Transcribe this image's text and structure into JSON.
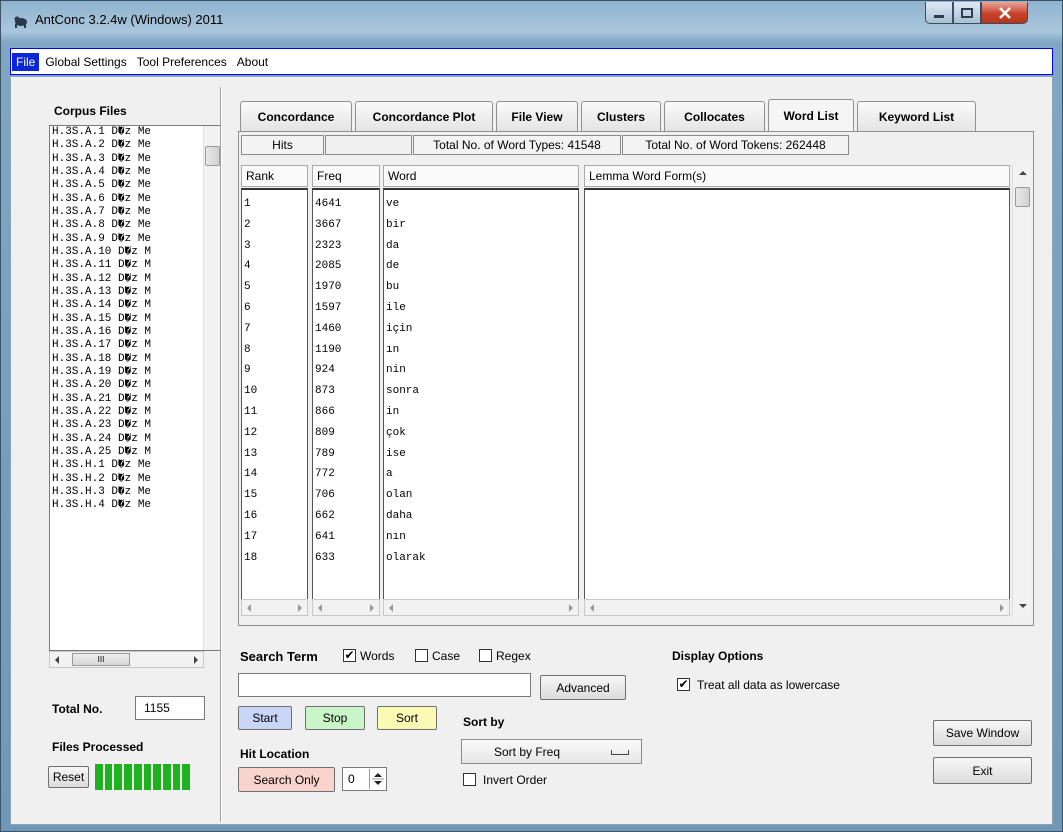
{
  "window": {
    "title": "AntConc 3.2.4w (Windows) 2011"
  },
  "menu": [
    "File",
    "Global Settings",
    "Tool Preferences",
    "About"
  ],
  "left_panel": {
    "corpus_files_label": "Corpus Files",
    "files": [
      "H.3S.A.1 D�z Me",
      "H.3S.A.2 D�z Me",
      "H.3S.A.3 D�z Me",
      "H.3S.A.4 D�z Me",
      "H.3S.A.5 D�z Me",
      "H.3S.A.6 D�z Me",
      "H.3S.A.7 D�z Me",
      "H.3S.A.8 D�z Me",
      "H.3S.A.9 D�z Me",
      "H.3S.A.10 D�z M",
      "H.3S.A.11 D�z M",
      "H.3S.A.12 D�z M",
      "H.3S.A.13 D�z M",
      "H.3S.A.14 D�z M",
      "H.3S.A.15 D�z M",
      "H.3S.A.16 D�z M",
      "H.3S.A.17 D�z M",
      "H.3S.A.18 D�z M",
      "H.3S.A.19 D�z M",
      "H.3S.A.20 D�z M",
      "H.3S.A.21 D�z M",
      "H.3S.A.22 D�z M",
      "H.3S.A.23 D�z M",
      "H.3S.A.24 D�z M",
      "H.3S.A.25 D�z M",
      "H.3S.H.1 D�z Me",
      "H.3S.H.2 D�z Me",
      "H.3S.H.3 D�z Me",
      "H.3S.H.4 D�z Me"
    ],
    "hscroll_glyph": "III",
    "total_no_label": "Total No.",
    "total_no_value": "1155",
    "files_processed_label": "Files Processed",
    "reset_label": "Reset",
    "progress_segments": 10
  },
  "tabs": [
    "Concordance",
    "Concordance Plot",
    "File View",
    "Clusters",
    "Collocates",
    "Word List",
    "Keyword List"
  ],
  "active_tab": "Word List",
  "stats": {
    "hits_label": "Hits",
    "hits_value": "",
    "word_types": "Total No. of Word Types: 41548",
    "word_tokens": "Total No. of Word Tokens: 262448"
  },
  "columns": {
    "rank": "Rank",
    "freq": "Freq",
    "word": "Word",
    "lemma": "Lemma Word Form(s)"
  },
  "rows": [
    {
      "rank": "1",
      "freq": "4641",
      "word": "ve"
    },
    {
      "rank": "2",
      "freq": "3667",
      "word": "bir"
    },
    {
      "rank": "3",
      "freq": "2323",
      "word": "da"
    },
    {
      "rank": "4",
      "freq": "2085",
      "word": "de"
    },
    {
      "rank": "5",
      "freq": "1970",
      "word": "bu"
    },
    {
      "rank": "6",
      "freq": "1597",
      "word": "ile"
    },
    {
      "rank": "7",
      "freq": "1460",
      "word": "için"
    },
    {
      "rank": "8",
      "freq": "1190",
      "word": "ın"
    },
    {
      "rank": "9",
      "freq": "924",
      "word": "nin"
    },
    {
      "rank": "10",
      "freq": "873",
      "word": "sonra"
    },
    {
      "rank": "11",
      "freq": "866",
      "word": "in"
    },
    {
      "rank": "12",
      "freq": "809",
      "word": "çok"
    },
    {
      "rank": "13",
      "freq": "789",
      "word": "ise"
    },
    {
      "rank": "14",
      "freq": "772",
      "word": "a"
    },
    {
      "rank": "15",
      "freq": "706",
      "word": "olan"
    },
    {
      "rank": "16",
      "freq": "662",
      "word": "daha"
    },
    {
      "rank": "17",
      "freq": "641",
      "word": "nın"
    },
    {
      "rank": "18",
      "freq": "633",
      "word": "olarak"
    }
  ],
  "search": {
    "term_label": "Search Term",
    "words_label": "Words",
    "words_checked": true,
    "case_label": "Case",
    "case_checked": false,
    "regex_label": "Regex",
    "regex_checked": false,
    "input_value": "",
    "advanced_label": "Advanced",
    "start_label": "Start",
    "stop_label": "Stop",
    "sort_label": "Sort",
    "hit_location_label": "Hit Location",
    "search_only_label": "Search Only",
    "spin_value": "0"
  },
  "sort": {
    "label": "Sort by",
    "selected": "Sort by Freq",
    "invert_label": "Invert Order",
    "invert_checked": false
  },
  "display": {
    "label": "Display Options",
    "lowercase_label": "Treat all data as lowercase",
    "lowercase_checked": true
  },
  "buttons": {
    "save_window": "Save Window",
    "exit": "Exit"
  },
  "colors": {
    "start": "#c9d6f8",
    "stop": "#c9f5c9",
    "sort": "#fbfab4",
    "search_only": "#f9d4cc",
    "progress": "#1eb21e",
    "menu_active": "#0b26d6"
  }
}
